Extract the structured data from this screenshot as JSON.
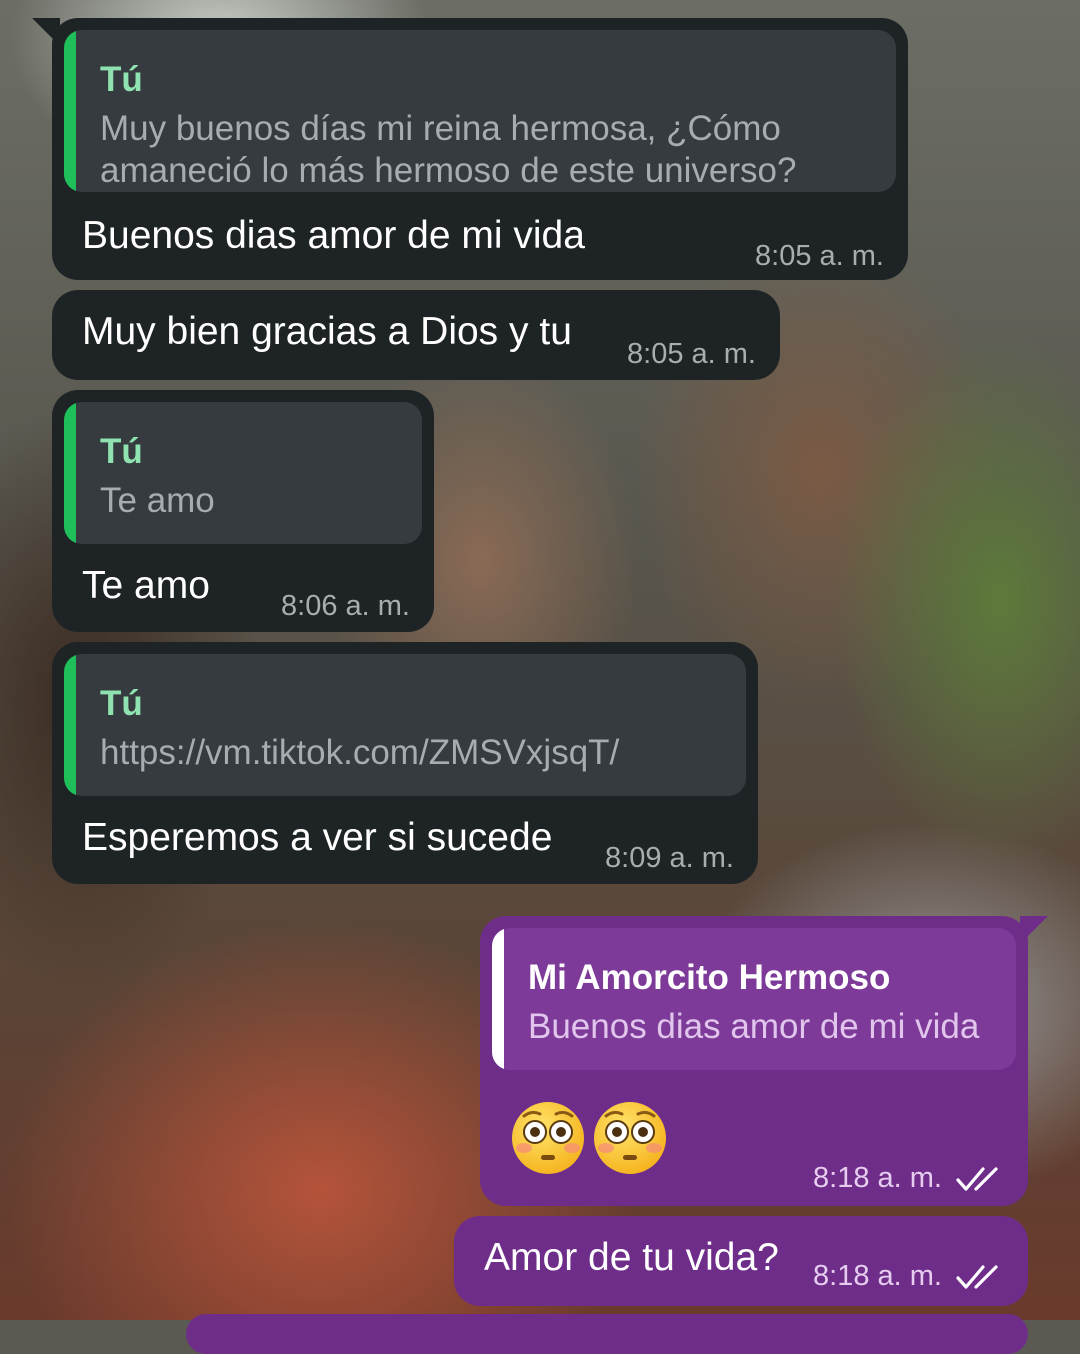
{
  "messages": [
    {
      "direction": "incoming",
      "quote": {
        "author": "Tú",
        "lines": [
          "Muy buenos días mi reina hermosa, ¿Cómo",
          "amaneció lo más hermoso de este universo?"
        ]
      },
      "text": "Buenos dias amor de mi vida",
      "time": "8:05 a. m."
    },
    {
      "direction": "incoming",
      "text": "Muy bien gracias a Dios y tu",
      "time": "8:05 a. m."
    },
    {
      "direction": "incoming",
      "quote": {
        "author": "Tú",
        "lines": [
          "Te amo"
        ]
      },
      "text": "Te amo",
      "time": "8:06 a. m."
    },
    {
      "direction": "incoming",
      "quote": {
        "author": "Tú",
        "lines": [
          "https://vm.tiktok.com/ZMSVxjsqT/"
        ]
      },
      "text": "Esperemos a ver si sucede",
      "time": "8:09 a. m."
    },
    {
      "direction": "outgoing",
      "quote": {
        "author": "Mi Amorcito Hermoso",
        "lines": [
          "Buenos dias amor de mi vida"
        ]
      },
      "emoji": [
        "flushed-face",
        "flushed-face"
      ],
      "time": "8:18 a. m.",
      "status": "read"
    },
    {
      "direction": "outgoing",
      "text": "Amor de tu vida?",
      "time": "8:18 a. m.",
      "status": "read"
    }
  ],
  "colors": {
    "incoming_bubble": "#1e2426",
    "outgoing_bubble": "#6f2d8a",
    "quote_bar_incoming": "#1fbf5a",
    "quote_bar_outgoing": "#ffffff"
  }
}
